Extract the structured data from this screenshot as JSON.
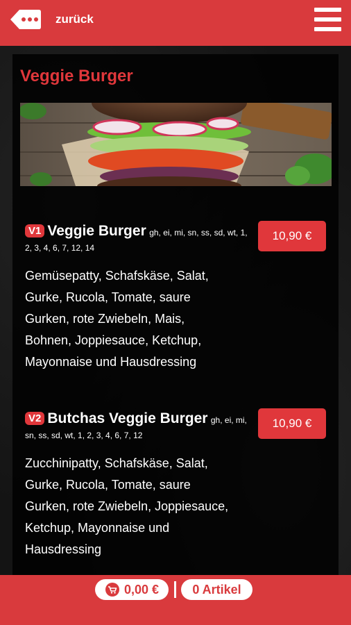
{
  "header": {
    "back_label": "zurück",
    "menu_icon": "hamburger-menu-icon",
    "back_icon": "back-dots-icon"
  },
  "category": {
    "title": "Veggie Burger",
    "image_icon": "veggie-burger-photo"
  },
  "items": [
    {
      "code": "V1",
      "name": "Veggie Burger",
      "allergens": "gh, ei, mi, sn, ss, sd, wt, 1, 2, 3, 4, 6, 7, 12, 14",
      "description": "Gemüsepatty, Schafskäse, Salat, Gurke, Rucola, Tomate, saure Gurken, rote Zwiebeln, Mais, Bohnen, Joppiesauce, Ketchup, Mayonnaise und Hausdressing",
      "price": "10,90 €"
    },
    {
      "code": "V2",
      "name": "Butchas Veggie Burger",
      "allergens": "gh, ei, mi, sn, ss, sd, wt, 1, 2, 3, 4, 6, 7, 12",
      "description": "Zucchinipatty, Schafskäse, Salat, Gurke, Rucola, Tomate, saure Gurken, rote Zwiebeln, Joppiesauce, Ketchup, Mayonnaise und Hausdressing",
      "price": "10,90 €"
    }
  ],
  "footer": {
    "cart_total": "0,00 €",
    "cart_icon": "shopping-cart-icon",
    "item_count": "0 Artikel"
  },
  "colors": {
    "brand_red": "#d93a3d",
    "accent_red": "#e0373b",
    "background": "#141414"
  }
}
